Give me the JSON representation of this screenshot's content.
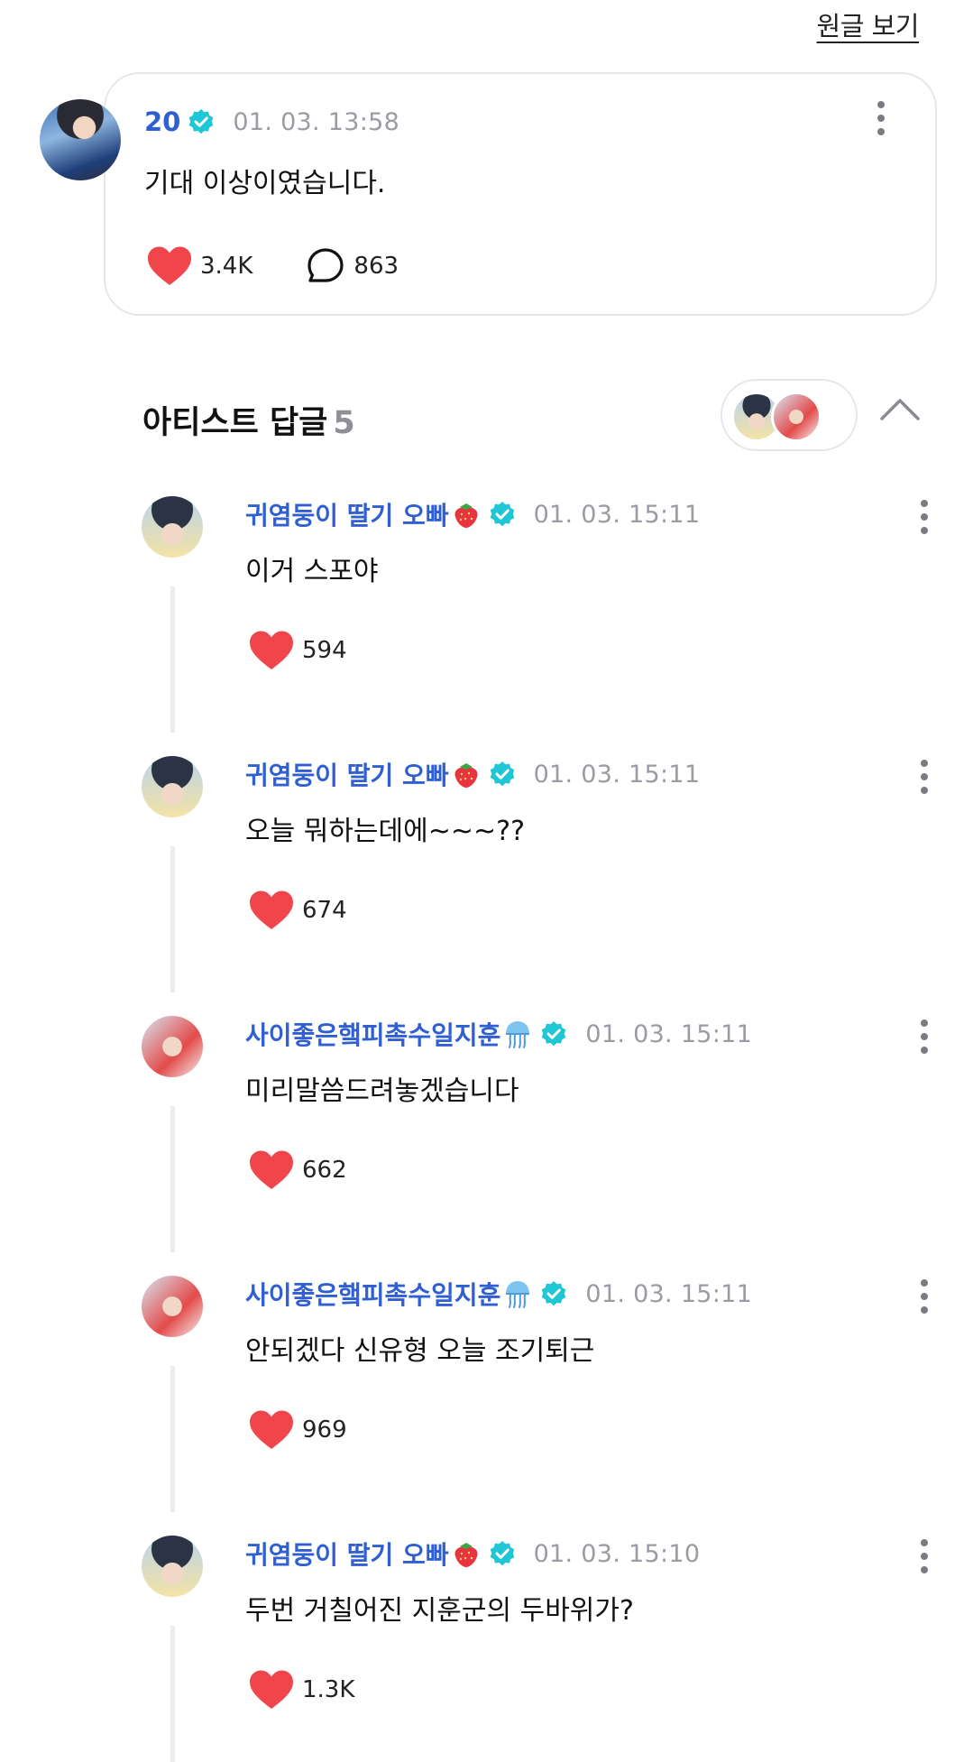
{
  "header": {
    "view_original_label": "원글 보기"
  },
  "post": {
    "author": "20",
    "timestamp": "01. 03. 13:58",
    "text": "기대 이상이였습니다.",
    "likes": "3.4K",
    "comments": "863"
  },
  "replies_section": {
    "title": "아티스트 답글",
    "count": "5"
  },
  "replies": [
    {
      "author": "귀염둥이 딸기 오빠",
      "emoji": "strawberry-icon",
      "timestamp": "01. 03. 15:11",
      "text": "이거 스포야",
      "likes": "594"
    },
    {
      "author": "귀염둥이 딸기 오빠",
      "emoji": "strawberry-icon",
      "timestamp": "01. 03. 15:11",
      "text": "오늘 뭐하는데에~~~??",
      "likes": "674"
    },
    {
      "author": "사이좋은햌피촉수일지훈",
      "emoji": "jellyfish-icon",
      "timestamp": "01. 03. 15:11",
      "text": "미리말씀드려놓겠습니다",
      "likes": "662"
    },
    {
      "author": "사이좋은햌피촉수일지훈",
      "emoji": "jellyfish-icon",
      "timestamp": "01. 03. 15:11",
      "text": "안되겠다 신유형 오늘 조기퇴근",
      "likes": "969"
    },
    {
      "author": "귀염둥이 딸기 오빠",
      "emoji": "strawberry-icon",
      "timestamp": "01. 03. 15:10",
      "text": "두번 거칠어진 지훈군의 두바위가?",
      "likes": "1.3K"
    }
  ],
  "colors": {
    "name_blue": "#2f5fd0",
    "verified_teal": "#1fc6d6",
    "heart_red": "#f0454a",
    "timestamp_gray": "#9a9ca3"
  }
}
